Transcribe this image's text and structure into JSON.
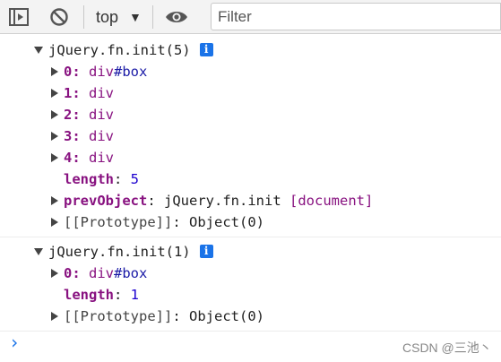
{
  "toolbar": {
    "context_label": "top",
    "filter_placeholder": "Filter",
    "icons": [
      "toggle-sidebar-icon",
      "clear-console-icon",
      "chevron-down-icon",
      "eye-icon"
    ]
  },
  "messages": [
    {
      "header": "jQuery.fn.init(5)",
      "items": [
        {
          "key": "0",
          "tag": "div",
          "id": "#box"
        },
        {
          "key": "1",
          "tag": "div"
        },
        {
          "key": "2",
          "tag": "div"
        },
        {
          "key": "3",
          "tag": "div"
        },
        {
          "key": "4",
          "tag": "div"
        }
      ],
      "length_key": "length",
      "length_value": "5",
      "prevObject_key": "prevObject",
      "prevObject_value": "jQuery.fn.init",
      "prevObject_ref": "document",
      "prototype_key": "[[Prototype]]",
      "prototype_value": "Object(0)"
    },
    {
      "header": "jQuery.fn.init(1)",
      "items": [
        {
          "key": "0",
          "tag": "div",
          "id": "#box"
        }
      ],
      "length_key": "length",
      "length_value": "1",
      "prototype_key": "[[Prototype]]",
      "prototype_value": "Object(0)"
    }
  ],
  "info_badge": "i",
  "prompt_symbol": "›",
  "watermark": "CSDN @三池丶",
  "colors": {
    "key": "#881280",
    "id": "#1a1aa6",
    "number": "#1c00cf",
    "accent": "#1a73e8",
    "toolbar_bg": "#f3f3f3"
  }
}
